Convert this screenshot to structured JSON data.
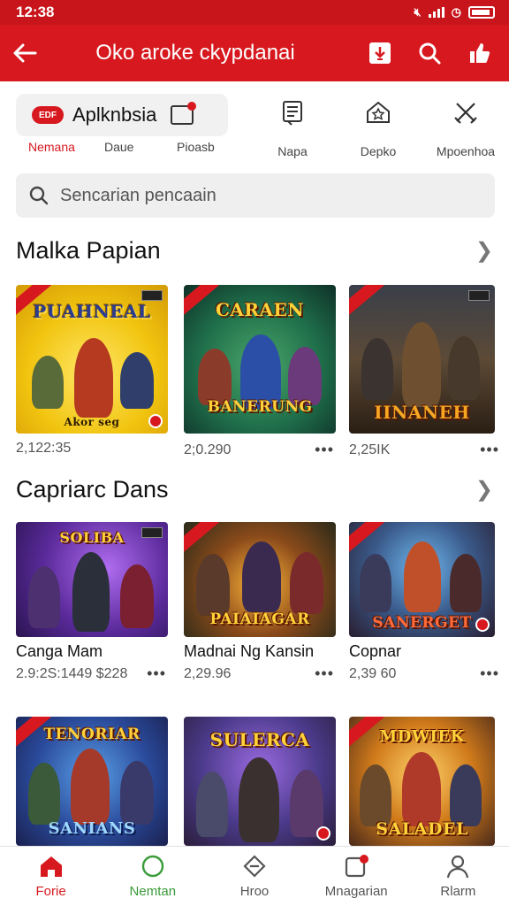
{
  "status_bar": {
    "time": "12:38"
  },
  "app_bar": {
    "title": "Oko aroke ckypdanai"
  },
  "quick_row": {
    "brand_logo_text": "EDF",
    "brand_name": "Aplknbsia",
    "labels": [
      "Nemana",
      "Daue",
      "Pioasb"
    ],
    "items": [
      {
        "label": "Napa",
        "icon": "document-icon"
      },
      {
        "label": "Depko",
        "icon": "home-star-icon"
      },
      {
        "label": "Mpoenhoa",
        "icon": "crossed-swords-icon"
      }
    ]
  },
  "search": {
    "placeholder": "Sencarian pencaain"
  },
  "sections": [
    {
      "title": "Malka Papian",
      "cards": [
        {
          "art_title": "PUAHNEAL",
          "art_footer": "Akor seg",
          "meta": "2,122:35"
        },
        {
          "art_title": "CARAEN",
          "art_footer": "BANERUNG",
          "meta": "2;0.290"
        },
        {
          "art_title": "",
          "art_footer": "IINANEH",
          "meta": "2,25IK"
        }
      ]
    },
    {
      "title": "Capriarc Dans",
      "cards": [
        {
          "art_title": "SOLIBA",
          "art_footer": "",
          "name": "Canga Mam",
          "meta": "2.9:2S:1449 $228"
        },
        {
          "art_title": "",
          "art_footer": "PAIAIAGAR",
          "name": "Madnai Ng Kansin",
          "meta": "2,29.96"
        },
        {
          "art_title": "",
          "art_footer": "SANERGET",
          "name": "Copnar",
          "meta": "2,39 60"
        }
      ]
    },
    {
      "title": "",
      "cards": [
        {
          "art_title": "TENORIAR",
          "art_footer": "SANIANS"
        },
        {
          "art_title": "SULERCA",
          "art_footer": ""
        },
        {
          "art_title": "MDWIEK",
          "art_footer": "SALADEL"
        }
      ]
    }
  ],
  "bottom_nav": [
    {
      "label": "Forie",
      "icon": "home-icon",
      "color": "#d7191f"
    },
    {
      "label": "Nemtan",
      "icon": "circle-icon",
      "color": "#3a9b3a"
    },
    {
      "label": "Hroo",
      "icon": "diamond-icon",
      "color": "#555555"
    },
    {
      "label": "Mnagarian",
      "icon": "inbox-icon",
      "color": "#555555"
    },
    {
      "label": "Rlarm",
      "icon": "person-icon",
      "color": "#555555"
    }
  ],
  "colors": {
    "primary": "#d7191f",
    "status_bar": "#c8141b",
    "search_bg": "#efefef"
  }
}
